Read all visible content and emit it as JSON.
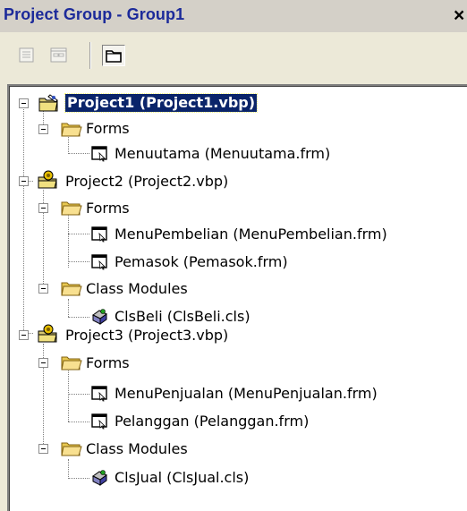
{
  "window": {
    "title": "Project Group - Group1",
    "close_glyph": "×"
  },
  "toolbar": {
    "buttons": [
      {
        "name": "view-code-icon",
        "state": "disabled"
      },
      {
        "name": "view-object-icon",
        "state": "disabled"
      },
      {
        "name": "toggle-folders-icon",
        "state": "pressed"
      }
    ]
  },
  "tree": {
    "project1": {
      "label": "Project1 (Project1.vbp)",
      "selected": true,
      "forms": {
        "label": "Forms",
        "items": [
          "Menuutama (Menuutama.frm)"
        ]
      }
    },
    "project2": {
      "label": "Project2 (Project2.vbp)",
      "forms": {
        "label": "Forms",
        "items": [
          "MenuPembelian (MenuPembelian.frm)",
          "Pemasok (Pemasok.frm)"
        ]
      },
      "classes": {
        "label": "Class Modules",
        "items": [
          "ClsBeli (ClsBeli.cls)"
        ]
      }
    },
    "project3": {
      "label": "Project3 (Project3.vbp)",
      "forms": {
        "label": "Forms",
        "items": [
          "MenuPenjualan (MenuPenjualan.frm)",
          "Pelanggan (Pelanggan.frm)"
        ]
      },
      "classes": {
        "label": "Class Modules",
        "items": [
          "ClsJual (ClsJual.cls)"
        ]
      }
    }
  },
  "colors": {
    "selection": "#0a246a",
    "title_text": "#1c2a9a",
    "panel_bg": "#ece9d8"
  }
}
